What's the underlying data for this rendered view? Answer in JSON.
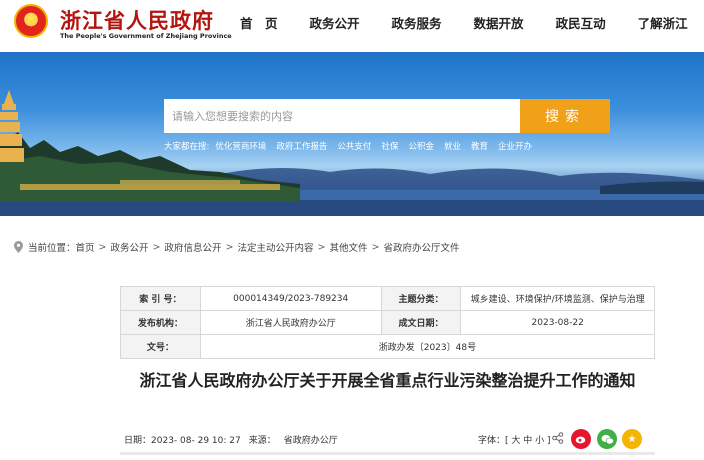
{
  "header": {
    "site_title": "浙江省人民政府",
    "site_subtitle": "The People's Government of Zhejiang Province",
    "nav": [
      "首　页",
      "政务公开",
      "政务服务",
      "数据开放",
      "政民互动",
      "了解浙江"
    ]
  },
  "search": {
    "placeholder": "请输入您想要搜索的内容",
    "button": "搜索",
    "hot_label": "大家都在搜:",
    "hot_items": [
      "优化营商环境",
      "政府工作报告",
      "公共支付",
      "社保",
      "公积金",
      "就业",
      "教育",
      "企业开办"
    ]
  },
  "breadcrumb": {
    "label": "当前位置：",
    "items": [
      "首页",
      "政务公开",
      "政府信息公开",
      "法定主动公开内容",
      "其他文件",
      "省政府办公厅文件"
    ],
    "separator": ">"
  },
  "info": {
    "index_label": "索 引 号：",
    "index_value": "000014349/2023-789234",
    "topic_label": "主题分类：",
    "topic_value": "城乡建设、环境保护/环境监测、保护与治理",
    "org_label": "发布机构：",
    "org_value": "浙江省人民政府办公厅",
    "date_label": "成文日期：",
    "date_value": "2023-08-22",
    "doc_label": "文号：",
    "doc_value": "浙政办发〔2023〕48号"
  },
  "article": {
    "title": "浙江省人民政府办公厅关于开展全省重点行业污染整治提升工作的通知",
    "date_label": "日期：",
    "date_value": "2023- 08- 29 10: 27",
    "source_label": "来源：",
    "source_value": "省政府办公厅",
    "font_label": "字体：",
    "font_options": "[ 大 中 小 ]"
  },
  "colors": {
    "brand_red": "#b3150f",
    "search_orange": "#f0a019"
  }
}
